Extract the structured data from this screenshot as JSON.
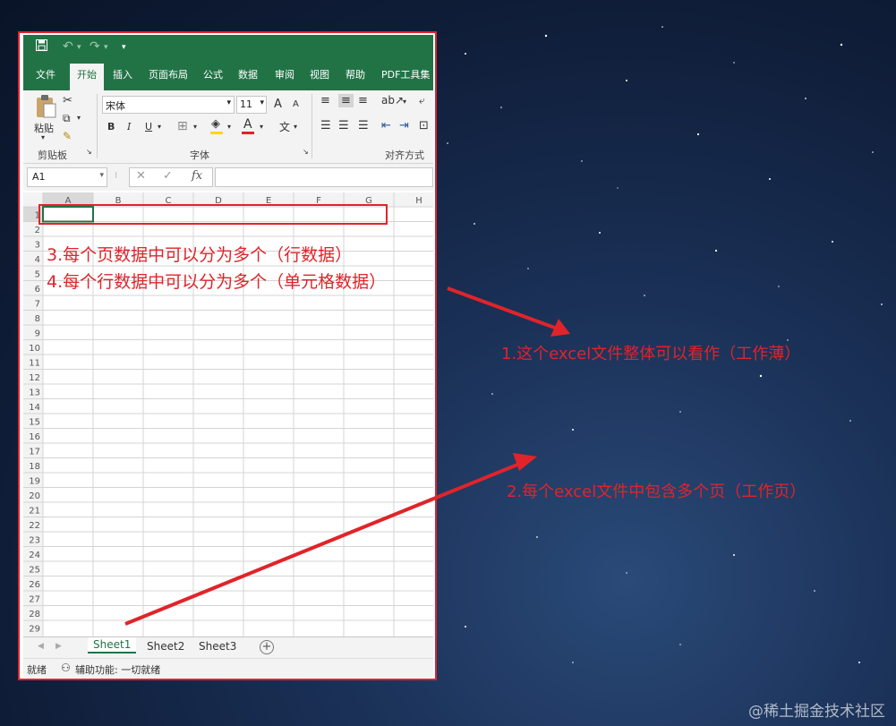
{
  "qat": {
    "save_icon": "save-icon",
    "undo_icon": "undo-icon",
    "redo_icon": "redo-icon",
    "customize_icon": "customize-icon"
  },
  "tabs": [
    "文件",
    "开始",
    "插入",
    "页面布局",
    "公式",
    "数据",
    "审阅",
    "视图",
    "帮助",
    "PDF工具集"
  ],
  "active_tab": "开始",
  "ribbon": {
    "paste_label": "粘贴",
    "clipboard_label": "剪贴板",
    "font_name": "宋体",
    "font_size": "11",
    "font_label": "字体",
    "align_label": "对齐方式",
    "bold": "B",
    "italic": "I",
    "underline": "U",
    "grow_font": "A",
    "shrink_font": "A",
    "font_color_glyph": "A",
    "phonetic_glyph": "文"
  },
  "formula_bar": {
    "name_box": "A1",
    "fx": "fx",
    "cancel": "✕",
    "enter": "✓"
  },
  "grid": {
    "columns": [
      "A",
      "B",
      "C",
      "D",
      "E",
      "F",
      "G",
      "H"
    ],
    "rows": [
      "1",
      "2",
      "3",
      "4",
      "5",
      "6",
      "7",
      "8",
      "9",
      "10",
      "11",
      "12",
      "13",
      "14",
      "15",
      "16",
      "17",
      "18",
      "19",
      "20",
      "21",
      "22",
      "23",
      "24",
      "25",
      "26",
      "27",
      "28",
      "29"
    ]
  },
  "sheets": {
    "tabs": [
      "Sheet1",
      "Sheet2",
      "Sheet3"
    ],
    "active": "Sheet1",
    "add": "+"
  },
  "status": {
    "ready": "就绪",
    "accessibility": "辅助功能: 一切就绪"
  },
  "annotations": {
    "note3": "3.每个页数据中可以分为多个（行数据）",
    "note4": "4.每个行数据中可以分为多个（单元格数据）",
    "note1": "1.这个excel文件整体可以看作（工作薄）",
    "note2": "2.每个excel文件中包含多个页（工作页）"
  },
  "watermark": "@稀土掘金技术社区",
  "colors": {
    "excel_green": "#217346",
    "annotation_red": "#e0242a"
  }
}
